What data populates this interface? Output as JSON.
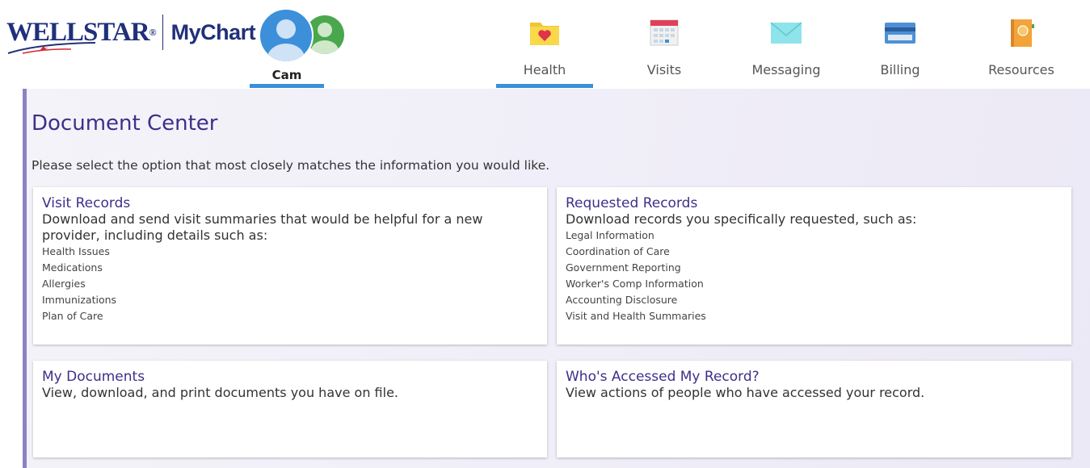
{
  "header": {
    "logo": {
      "brand": "WELLSTAR",
      "registered": "®",
      "product": "MyChart"
    },
    "user": {
      "name": "Cam"
    },
    "nav": [
      {
        "label": "Health",
        "icon": "folder-heart-icon",
        "active": true
      },
      {
        "label": "Visits",
        "icon": "calendar-icon",
        "active": false
      },
      {
        "label": "Messaging",
        "icon": "envelope-icon",
        "active": false
      },
      {
        "label": "Billing",
        "icon": "credit-card-icon",
        "active": false
      },
      {
        "label": "Resources",
        "icon": "book-icon",
        "active": false
      }
    ]
  },
  "main": {
    "title": "Document Center",
    "description": "Please select the option that most closely matches the information you would like.",
    "cards": [
      {
        "title": "Visit Records",
        "description": "Download and send visit summaries that would be helpful for a new provider, including details such as:",
        "items": [
          "Health Issues",
          "Medications",
          "Allergies",
          "Immunizations",
          "Plan of Care"
        ]
      },
      {
        "title": "Requested Records",
        "description": "Download records you specifically requested, such as:",
        "items": [
          "Legal Information",
          "Coordination of Care",
          "Government Reporting",
          "Worker's Comp Information",
          "Accounting Disclosure",
          "Visit and Health Summaries"
        ]
      },
      {
        "title": "My Documents",
        "description": "View, download, and print documents you have on file.",
        "items": []
      },
      {
        "title": "Who's Accessed My Record?",
        "description": "View actions of people who have accessed your record.",
        "items": []
      }
    ]
  },
  "colors": {
    "brand_navy": "#20307a",
    "accent_blue": "#3b90d9",
    "title_purple": "#3e2f8a",
    "panel_border": "#8b82c4"
  }
}
